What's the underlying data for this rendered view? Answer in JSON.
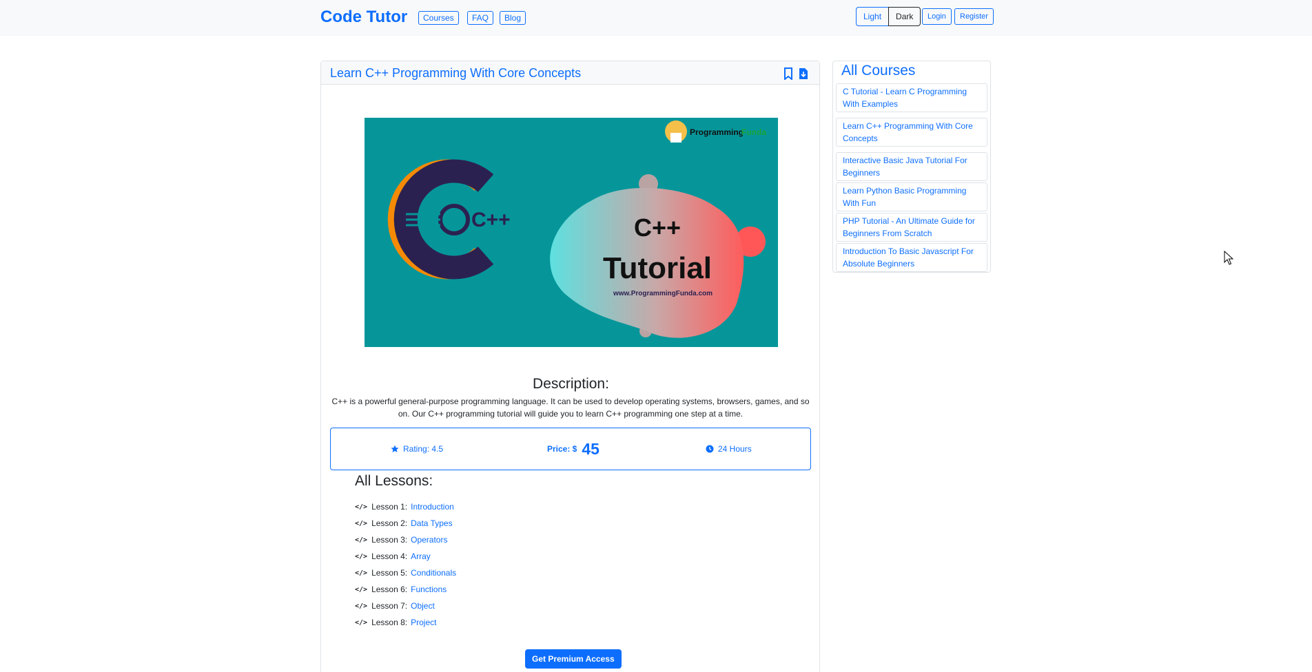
{
  "navbar": {
    "brand": "Code Tutor",
    "links": [
      "Courses",
      "FAQ",
      "Blog"
    ],
    "theme": {
      "light": "Light",
      "dark": "Dark"
    },
    "login": "Login",
    "register": "Register"
  },
  "course": {
    "title": "Learn C++ Programming With Core Concepts",
    "banner": {
      "logo_text_1": "Programming",
      "logo_text_2": "Funda",
      "badge": "C++",
      "headline_1": "C++",
      "headline_2": "Tutorial",
      "url": "www.ProgrammingFunda.com"
    },
    "description_title": "Description:",
    "description": "C++ is a powerful general-purpose programming language. It can be used to develop operating systems, browsers, games, and so on. Our C++ programming tutorial will guide you to learn C++ programming one step at a time.",
    "rating": "Rating: 4.5",
    "price_label": "Price: $",
    "price_value": "45",
    "duration": "24 Hours",
    "lessons_title": "All Lessons:",
    "lessons": [
      {
        "code": "</>",
        "num": "Lesson 1:",
        "name": "Introduction"
      },
      {
        "code": "</>",
        "num": "Lesson 2:",
        "name": "Data Types"
      },
      {
        "code": "</>",
        "num": "Lesson 3:",
        "name": "Operators"
      },
      {
        "code": "</>",
        "num": "Lesson 4:",
        "name": "Array"
      },
      {
        "code": "</>",
        "num": "Lesson 5:",
        "name": "Conditionals"
      },
      {
        "code": "</>",
        "num": "Lesson 6:",
        "name": "Functions"
      },
      {
        "code": "</>",
        "num": "Lesson 7:",
        "name": "Object"
      },
      {
        "code": "</>",
        "num": "Lesson 8:",
        "name": "Project"
      }
    ],
    "premium_button": "Get Premium Access"
  },
  "sidebar": {
    "title": "All Courses",
    "items": [
      "C Tutorial - Learn C Programming With Examples",
      "Learn C++ Programming With Core Concepts",
      "Interactive Basic Java Tutorial For Beginners",
      "Learn Python Basic Programming With Fun",
      "PHP Tutorial - An Ultimate Guide for Beginners From Scratch",
      "Introduction To Basic Javascript For Absolute Beginners"
    ]
  },
  "colors": {
    "primary": "#0d6efd",
    "banner_bg": "#06969a"
  },
  "icons": [
    "bookmark-icon",
    "download-icon",
    "star-icon",
    "clock-icon",
    "code-icon",
    "cursor-icon"
  ]
}
